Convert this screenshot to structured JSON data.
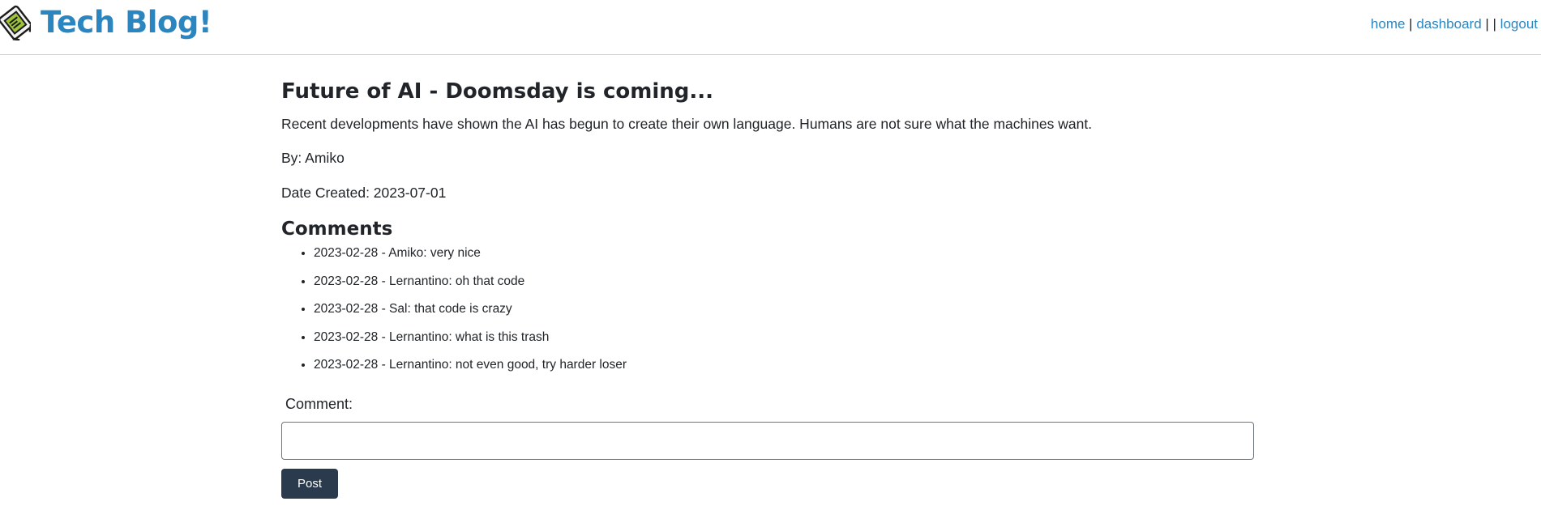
{
  "header": {
    "brand_title": "Tech Blog!",
    "logo_icon": "tech-blog-logo-icon",
    "nav": {
      "home": "home",
      "sep1": " | ",
      "dashboard": "dashboard",
      "sep2": " | | ",
      "logout": "logout"
    }
  },
  "post": {
    "title": "Future of AI - Doomsday is coming...",
    "body": "Recent developments have shown the AI has begun to create their own language. Humans are not sure what the machines want.",
    "author": "By: Amiko",
    "date": "Date Created: 2023-07-01"
  },
  "comments": {
    "heading": "Comments",
    "items": [
      "2023-02-28 - Amiko: very nice",
      "2023-02-28 - Lernantino: oh that code",
      "2023-02-28 - Sal: that code is crazy",
      "2023-02-28 - Lernantino: what is this trash",
      "2023-02-28 - Lernantino: not even good, try harder loser"
    ]
  },
  "form": {
    "label": "Comment:",
    "input_value": "",
    "submit_label": "Post"
  },
  "colors": {
    "brand": "#2b86c0",
    "button": "#2b3b4e"
  }
}
